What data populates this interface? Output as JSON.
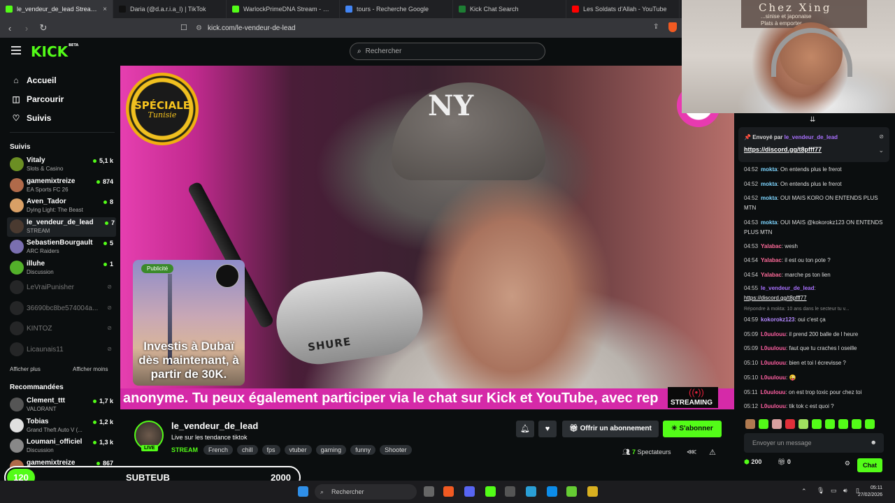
{
  "tabs": [
    {
      "title": "le_vendeur_de_lead Stream - W",
      "color": "#53fc18",
      "active": true
    },
    {
      "title": "Daria (@d.a.r.i.a_l) | TikTok",
      "color": "#111111"
    },
    {
      "title": "WarlockPrimeDNA Stream - Watch",
      "color": "#53fc18"
    },
    {
      "title": "tours - Recherche Google",
      "color": "#4285f4"
    },
    {
      "title": "Kick Chat Search",
      "color": "#1e7e34"
    },
    {
      "title": "Les Soldats d'Allah - YouTube",
      "color": "#ff0000"
    }
  ],
  "address": "kick.com/le-vendeur-de-lead",
  "kick": {
    "logo": "KICK",
    "logo_badge": "BETA",
    "search_placeholder": "Rechercher",
    "nav": [
      "Accueil",
      "Parcourir",
      "Suivis"
    ]
  },
  "sidebar": {
    "following_title": "Suivis",
    "following": [
      {
        "name": "Vitaly",
        "category": "Slots & Casino",
        "viewers": "5,1 k",
        "color": "#6b8e23"
      },
      {
        "name": "gamemixtreize",
        "category": "EA Sports FC 26",
        "viewers": "874",
        "color": "#b06a4a"
      },
      {
        "name": "Aven_Tador",
        "category": "Dying Light: The Beast",
        "viewers": "8",
        "color": "#d9a066"
      },
      {
        "name": "le_vendeur_de_lead",
        "category": "STREAM",
        "viewers": "7",
        "color": "#4a3a30",
        "selected": true
      },
      {
        "name": "SebastienBourgault",
        "category": "ARC Raiders",
        "viewers": "5",
        "color": "#7a6fb0"
      },
      {
        "name": "illuhe",
        "category": "Discussion",
        "viewers": "1",
        "color": "#53b02a"
      }
    ],
    "offline": [
      "LeVraiPunisher",
      "36690bc8be574004a...",
      "KINTOZ",
      "Licaunais11"
    ],
    "show_more": "Afficher plus",
    "show_less": "Afficher moins",
    "recommended_title": "Recommandées",
    "recommended": [
      {
        "name": "Clement_ttt",
        "category": "VALORANT",
        "viewers": "1,7 k",
        "color": "#555555"
      },
      {
        "name": "Tobias",
        "category": "Grand Theft Auto V (...",
        "viewers": "1,2 k",
        "color": "#e0e0e0"
      },
      {
        "name": "Loumani_officiel",
        "category": "Discussion",
        "viewers": "1,3 k",
        "color": "#888888"
      },
      {
        "name": "gamemixtreize",
        "category": "EA Sports FC 26",
        "viewers": "867",
        "color": "#b06a4a"
      }
    ]
  },
  "video": {
    "logo_line1": "SPÉCIALE",
    "logo_line2": "Tunisie",
    "mic_brand": "SHURE",
    "ad_badge": "Publicité",
    "ad_text": "Investis à Dubaï dès maintenant, à partir de 30K.",
    "ticker": "anonyme. Tu peux également participer via le chat sur Kick et YouTube, avec rep",
    "stream_tag": "STREAMING"
  },
  "webcam": {
    "sign_title": "Chez Xing",
    "sign_line1": "...sinise et japonaise",
    "sign_line2": "Plats à emporter"
  },
  "chat": {
    "pinned_by_label": "Envoyé par",
    "pinned_by_user": "le_vendeur_de_lead",
    "pinned_link": "https://discord.gg/t8pfff77",
    "messages": [
      {
        "time": "04:52",
        "user": "mokta",
        "color": "#7dd3fc",
        "text": "On entends plus le frerot"
      },
      {
        "time": "04:52",
        "user": "mokta",
        "color": "#7dd3fc",
        "text": "On entends plus le frerot"
      },
      {
        "time": "04:52",
        "user": "mokta",
        "color": "#7dd3fc",
        "text": "OUI MAIS KORO ON ENTENDS PLUS MTN"
      },
      {
        "time": "04:53",
        "user": "mokta",
        "color": "#7dd3fc",
        "text": "OUI MAIS @kokorokz123 ON ENTENDS PLUS MTN"
      },
      {
        "time": "04:53",
        "user": "Yalabac",
        "color": "#ff6b9a",
        "text": "wesh"
      },
      {
        "time": "04:54",
        "user": "Yalabac",
        "color": "#ff6b9a",
        "text": "il est ou ton pote ?"
      },
      {
        "time": "04:54",
        "user": "Yalabac",
        "color": "#ff6b9a",
        "text": "marche ps ton lien"
      },
      {
        "time": "04:55",
        "user": "le_vendeur_de_lead",
        "color": "#a970ff",
        "text": "https://discord.gg/t8pfff77",
        "link": true
      },
      {
        "time": "04:59",
        "user": "kokorokz123",
        "color": "#b388ff",
        "text": "oui c'est ça"
      },
      {
        "time": "05:09",
        "user": "L0uulouu",
        "color": "#ff5fa2",
        "text": "il prend 200 balle de l heure"
      },
      {
        "time": "05:09",
        "user": "L0uulouu",
        "color": "#ff5fa2",
        "text": "faut que tu craches l oseille"
      },
      {
        "time": "05:10",
        "user": "L0uulouu",
        "color": "#ff5fa2",
        "text": "bien et toi l écrevisse ?"
      },
      {
        "time": "05:10",
        "user": "L0uulouu",
        "color": "#ff5fa2",
        "text": "😜"
      },
      {
        "time": "05:11",
        "user": "L0uulouu",
        "color": "#ff5fa2",
        "text": "on est trop toxic pour chez toi"
      },
      {
        "time": "05:12",
        "user": "L0uulouu",
        "color": "#ff5fa2",
        "text": "tik tok c est quoi ?"
      }
    ],
    "reply_text": "Répondre à mokta: 10 ans dans le secteur tu v...",
    "input_placeholder": "Envoyer un message",
    "points": "200",
    "gifts": "0",
    "chat_button": "Chat"
  },
  "streamer": {
    "name": "le_vendeur_de_lead",
    "live": "LIVE",
    "title": "Live sur les tendance tiktok",
    "category": "STREAM",
    "tags": [
      "French",
      "chill",
      "fps",
      "vtuber",
      "gaming",
      "funny",
      "Shooter"
    ],
    "gift_button": "Offrir un abonnement",
    "subscribe_button": "S'abonner",
    "viewers": "7",
    "viewers_label": "Spectateurs"
  },
  "subgoal": {
    "current": "120",
    "label": "SUBTEUB",
    "goal": "2000"
  },
  "taskbar": {
    "search": "Rechercher",
    "time": "05:11",
    "date": "27/02/2026"
  }
}
